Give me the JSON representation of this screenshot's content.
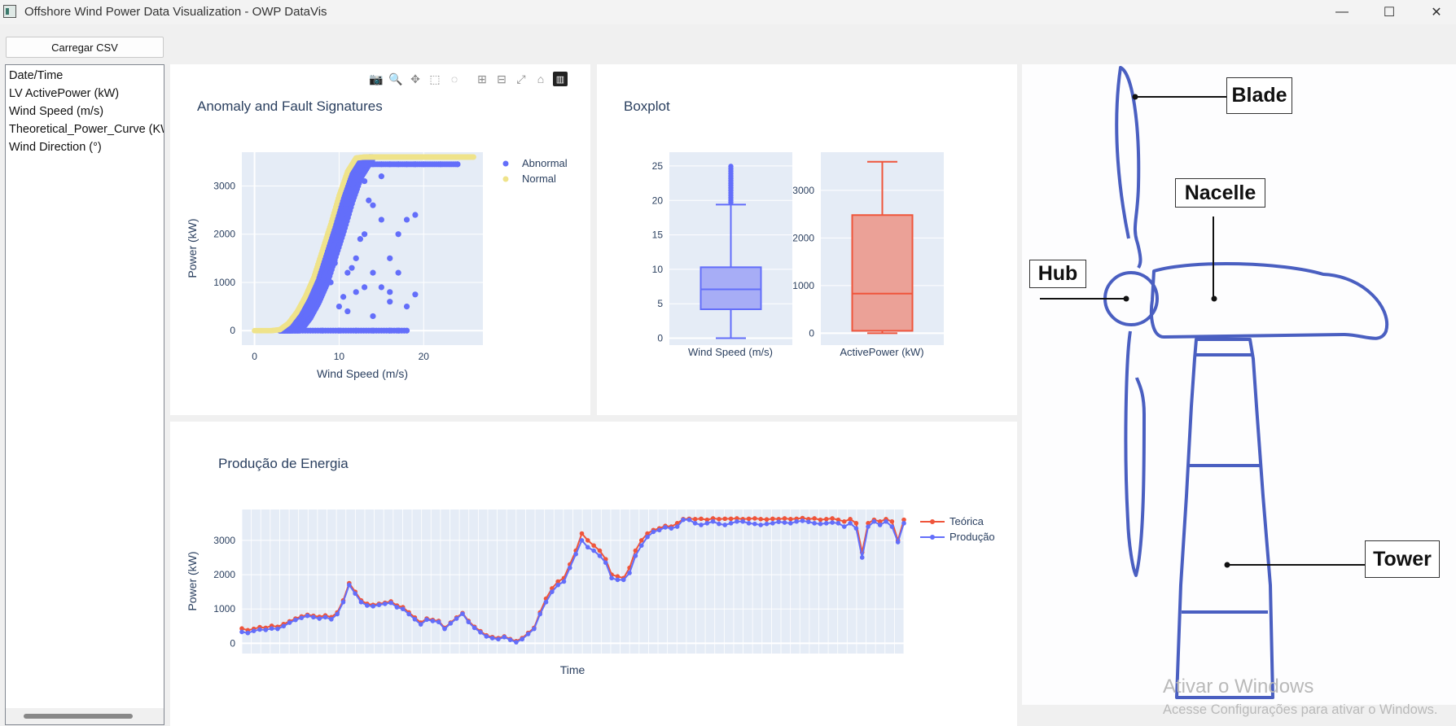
{
  "window": {
    "title": "Offshore Wind Power Data Visualization - OWP DataVis",
    "minimize": "—",
    "maximize": "☐",
    "close": "✕"
  },
  "toolbar": {
    "load_csv_label": "Carregar CSV"
  },
  "columns": [
    "Date/Time",
    "LV ActivePower (kW)",
    "Wind Speed (m/s)",
    "Theoretical_Power_Curve (KWh)",
    "Wind Direction (°)"
  ],
  "modebar_icons": [
    "camera-icon",
    "zoom-icon",
    "pan-icon",
    "box-select-icon",
    "lasso-icon",
    "zoom-in-icon",
    "zoom-out-icon",
    "autoscale-icon",
    "reset-axes-icon",
    "plotly-logo-icon"
  ],
  "colors": {
    "series1": "#636efa",
    "series2": "#ef553b",
    "normal": "#efe38a",
    "plot_bg": "#e5ecf6",
    "turbine": "#4a5fc1"
  },
  "scatter": {
    "title": "Anomaly and Fault Signatures",
    "xlabel": "Wind Speed (m/s)",
    "ylabel": "Power (kW)",
    "xticks": [
      "0",
      "10",
      "20"
    ],
    "yticks": [
      "0",
      "1000",
      "2000",
      "3000"
    ],
    "legend": [
      "Abnormal",
      "Normal"
    ]
  },
  "boxplot": {
    "title": "Boxplot",
    "left_ticks": [
      "0",
      "5",
      "10",
      "15",
      "20",
      "25"
    ],
    "right_ticks": [
      "0",
      "1000",
      "2000",
      "3000"
    ],
    "left_label": "Wind Speed (m/s)",
    "right_label": "ActivePower (kW)"
  },
  "line": {
    "title": "Produção de Energia",
    "xlabel": "Time",
    "ylabel": "Power (kW)",
    "yticks": [
      "0",
      "1000",
      "2000",
      "3000"
    ],
    "legend": [
      "Teórica",
      "Produção"
    ]
  },
  "chart_data": [
    {
      "type": "scatter",
      "title": "Anomaly and Fault Signatures",
      "xlabel": "Wind Speed (m/s)",
      "ylabel": "Power (kW)",
      "xlim": [
        -1.5,
        27
      ],
      "ylim": [
        -300,
        3700
      ],
      "grid": true,
      "legend_position": "right",
      "series": [
        {
          "name": "Normal",
          "curve": true,
          "points": [
            [
              0,
              0
            ],
            [
              2,
              0
            ],
            [
              3,
              20
            ],
            [
              4,
              150
            ],
            [
              5,
              380
            ],
            [
              6,
              700
            ],
            [
              7,
              1100
            ],
            [
              8,
              1650
            ],
            [
              9,
              2200
            ],
            [
              10,
              2800
            ],
            [
              11,
              3300
            ],
            [
              12,
              3580
            ],
            [
              13,
              3600
            ],
            [
              26,
              3600
            ]
          ]
        },
        {
          "name": "Abnormal",
          "points": [
            [
              3.5,
              0
            ],
            [
              5,
              100
            ],
            [
              6,
              400
            ],
            [
              7,
              700
            ],
            [
              8,
              900
            ],
            [
              9,
              1000
            ],
            [
              9.5,
              1400
            ],
            [
              10,
              1800
            ],
            [
              10.5,
              2100
            ],
            [
              11,
              2600
            ],
            [
              11.5,
              2900
            ],
            [
              12,
              3100
            ],
            [
              12.5,
              3300
            ],
            [
              13,
              3450
            ],
            [
              14,
              3450
            ],
            [
              15,
              3450
            ],
            [
              16,
              3450
            ],
            [
              17,
              3450
            ],
            [
              18,
              3450
            ],
            [
              19,
              3450
            ],
            [
              20,
              3450
            ],
            [
              22,
              3450
            ],
            [
              24,
              3450
            ],
            [
              10,
              500
            ],
            [
              11,
              1200
            ],
            [
              12,
              800
            ],
            [
              12,
              1500
            ],
            [
              13,
              2000
            ],
            [
              13,
              900
            ],
            [
              14,
              2600
            ],
            [
              14,
              1200
            ],
            [
              15,
              2300
            ],
            [
              15,
              900
            ],
            [
              16,
              1500
            ],
            [
              16,
              800
            ],
            [
              17,
              1200
            ],
            [
              17,
              2000
            ],
            [
              18,
              2300
            ],
            [
              18,
              500
            ],
            [
              19,
              2400
            ],
            [
              19,
              750
            ],
            [
              14,
              300
            ],
            [
              16,
              600
            ],
            [
              8,
              0
            ],
            [
              10,
              0
            ],
            [
              12,
              0
            ],
            [
              14,
              0
            ],
            [
              16,
              0
            ],
            [
              17,
              0
            ],
            [
              18,
              0
            ],
            [
              11,
              400
            ],
            [
              13,
              3100
            ],
            [
              15,
              3200
            ],
            [
              13.5,
              2700
            ],
            [
              12.5,
              1900
            ],
            [
              11.5,
              1300
            ],
            [
              10.5,
              700
            ]
          ]
        }
      ]
    },
    {
      "type": "box",
      "title": "Boxplot",
      "boxes": [
        {
          "name": "Wind Speed (m/s)",
          "min": 0,
          "q1": 4.2,
          "median": 7.1,
          "q3": 10.3,
          "max": 19.4,
          "outliers_to": 25.2,
          "ylim": [
            -1,
            27
          ]
        },
        {
          "name": "ActivePower (kW)",
          "min": 0,
          "q1": 50,
          "median": 830,
          "q3": 2480,
          "max": 3600,
          "ylim": [
            -250,
            3800
          ]
        }
      ]
    },
    {
      "type": "line",
      "title": "Produção de Energia",
      "xlabel": "Time",
      "ylabel": "Power (kW)",
      "ylim": [
        -300,
        3900
      ],
      "grid": true,
      "legend_position": "right",
      "series": [
        {
          "name": "Teórica",
          "values": [
            430,
            380,
            420,
            470,
            450,
            510,
            480,
            560,
            640,
            720,
            780,
            830,
            800,
            770,
            810,
            760,
            900,
            1250,
            1750,
            1500,
            1250,
            1150,
            1120,
            1150,
            1180,
            1220,
            1100,
            1050,
            900,
            750,
            600,
            720,
            680,
            650,
            450,
            600,
            750,
            880,
            650,
            480,
            350,
            230,
            180,
            150,
            200,
            120,
            60,
            150,
            300,
            450,
            900,
            1300,
            1600,
            1800,
            1900,
            2300,
            2700,
            3200,
            3000,
            2850,
            2700,
            2450,
            2000,
            1950,
            1900,
            2200,
            2700,
            3000,
            3200,
            3300,
            3350,
            3420,
            3400,
            3500,
            3620,
            3630,
            3620,
            3630,
            3600,
            3640,
            3620,
            3630,
            3630,
            3640,
            3620,
            3630,
            3640,
            3620,
            3610,
            3630,
            3620,
            3640,
            3620,
            3630,
            3650,
            3620,
            3640,
            3600,
            3620,
            3640,
            3600,
            3550,
            3620,
            3500,
            2650,
            3500,
            3600,
            3550,
            3620,
            3550,
            3000,
            3600
          ]
        },
        {
          "name": "Produção",
          "values": [
            330,
            300,
            360,
            400,
            390,
            430,
            420,
            500,
            600,
            680,
            740,
            800,
            760,
            720,
            760,
            700,
            850,
            1200,
            1700,
            1450,
            1200,
            1100,
            1080,
            1120,
            1150,
            1180,
            1050,
            1000,
            850,
            700,
            550,
            690,
            650,
            620,
            420,
            580,
            720,
            860,
            620,
            450,
            320,
            200,
            150,
            120,
            180,
            100,
            30,
            120,
            270,
            420,
            850,
            1200,
            1500,
            1700,
            1800,
            2200,
            2600,
            3000,
            2800,
            2700,
            2550,
            2350,
            1900,
            1850,
            1850,
            2050,
            2550,
            2850,
            3100,
            3250,
            3300,
            3380,
            3350,
            3400,
            3600,
            3600,
            3500,
            3450,
            3500,
            3550,
            3480,
            3450,
            3500,
            3550,
            3550,
            3500,
            3480,
            3450,
            3480,
            3500,
            3540,
            3520,
            3500,
            3550,
            3570,
            3540,
            3500,
            3480,
            3500,
            3520,
            3500,
            3400,
            3500,
            3350,
            2500,
            3400,
            3550,
            3450,
            3550,
            3400,
            2950,
            3500
          ]
        }
      ]
    }
  ],
  "turbine_labels": {
    "blade": "Blade",
    "nacelle": "Nacelle",
    "hub": "Hub",
    "tower": "Tower"
  },
  "watermark": {
    "line1": "Ativar o Windows",
    "line2": "Acesse Configurações para ativar o Windows."
  }
}
